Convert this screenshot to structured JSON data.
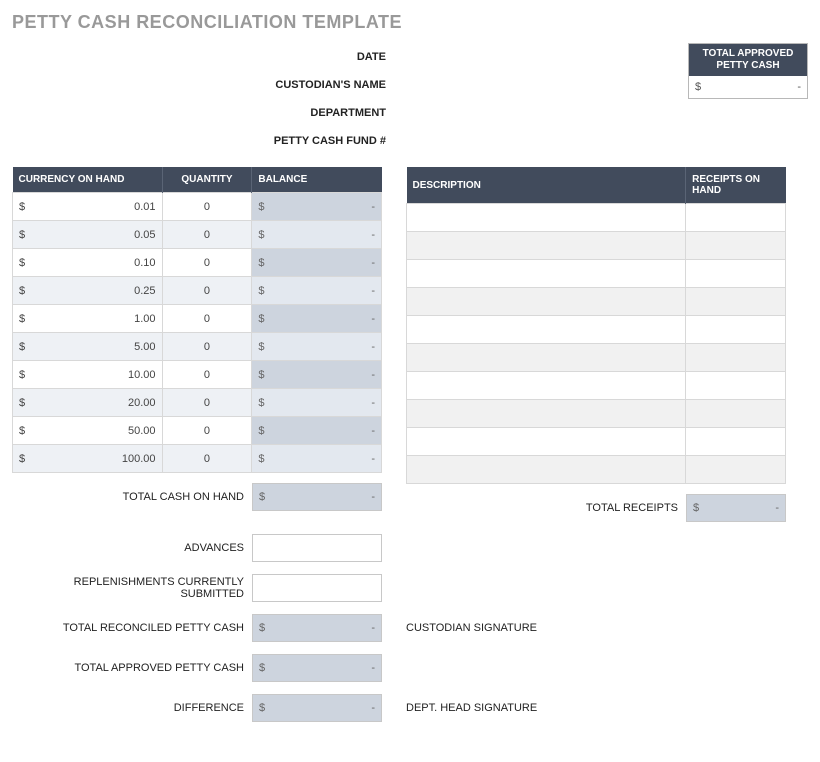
{
  "title": "PETTY CASH RECONCILIATION TEMPLATE",
  "info": {
    "date_label": "DATE",
    "custodian_label": "CUSTODIAN'S NAME",
    "department_label": "DEPARTMENT",
    "fund_label": "PETTY CASH FUND #"
  },
  "approved_box": {
    "header": "TOTAL APPROVED PETTY CASH",
    "symbol": "$",
    "value": "-"
  },
  "left_table": {
    "headers": {
      "currency": "CURRENCY ON HAND",
      "quantity": "QUANTITY",
      "balance": "BALANCE"
    },
    "rows": [
      {
        "amount": "0.01",
        "qty": "0"
      },
      {
        "amount": "0.05",
        "qty": "0"
      },
      {
        "amount": "0.10",
        "qty": "0"
      },
      {
        "amount": "0.25",
        "qty": "0"
      },
      {
        "amount": "1.00",
        "qty": "0"
      },
      {
        "amount": "5.00",
        "qty": "0"
      },
      {
        "amount": "10.00",
        "qty": "0"
      },
      {
        "amount": "20.00",
        "qty": "0"
      },
      {
        "amount": "50.00",
        "qty": "0"
      },
      {
        "amount": "100.00",
        "qty": "0"
      }
    ],
    "symbol": "$",
    "dash": "-"
  },
  "right_table": {
    "headers": {
      "description": "DESCRIPTION",
      "receipts": "RECEIPTS ON HAND"
    },
    "row_count": 10
  },
  "summaries": {
    "total_cash_on_hand": "TOTAL CASH ON HAND",
    "advances": "ADVANCES",
    "replenishments": "REPLENISHMENTS CURRENTLY SUBMITTED",
    "total_reconciled": "TOTAL RECONCILED PETTY CASH",
    "total_approved": "TOTAL APPROVED PETTY CASH",
    "difference": "DIFFERENCE",
    "total_receipts": "TOTAL RECEIPTS",
    "custodian_sig": "CUSTODIAN SIGNATURE",
    "dept_sig": "DEPT. HEAD SIGNATURE",
    "symbol": "$",
    "dash": "-"
  }
}
